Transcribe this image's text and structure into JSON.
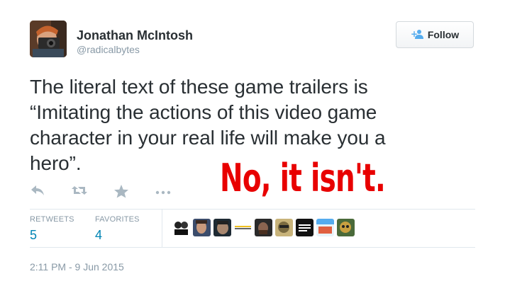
{
  "author": {
    "name": "Jonathan McIntosh",
    "handle": "@radicalbytes"
  },
  "follow_button": {
    "label": "Follow",
    "icon": "follow-person-icon"
  },
  "tweet": {
    "lines": [
      "The literal text of these game trailers is",
      "“Imitating the actions of this video game",
      "character in your real life will make you a",
      "hero”."
    ]
  },
  "overlay_text": "No, it isn't.",
  "actions": [
    {
      "name": "reply",
      "icon": "reply-icon"
    },
    {
      "name": "retweet",
      "icon": "retweet-icon"
    },
    {
      "name": "favorite",
      "icon": "favorite-star-icon"
    },
    {
      "name": "more",
      "icon": "more-dots-icon"
    }
  ],
  "stats": {
    "retweets": {
      "label": "RETWEETS",
      "value": "5"
    },
    "favorites": {
      "label": "FAVORITES",
      "value": "4"
    }
  },
  "favoriter_count": 10,
  "timestamp": "2:11 PM - 9 Jun 2015",
  "colors": {
    "link": "#0084b4",
    "muted": "#8899a6",
    "overlay": "#e80000"
  }
}
